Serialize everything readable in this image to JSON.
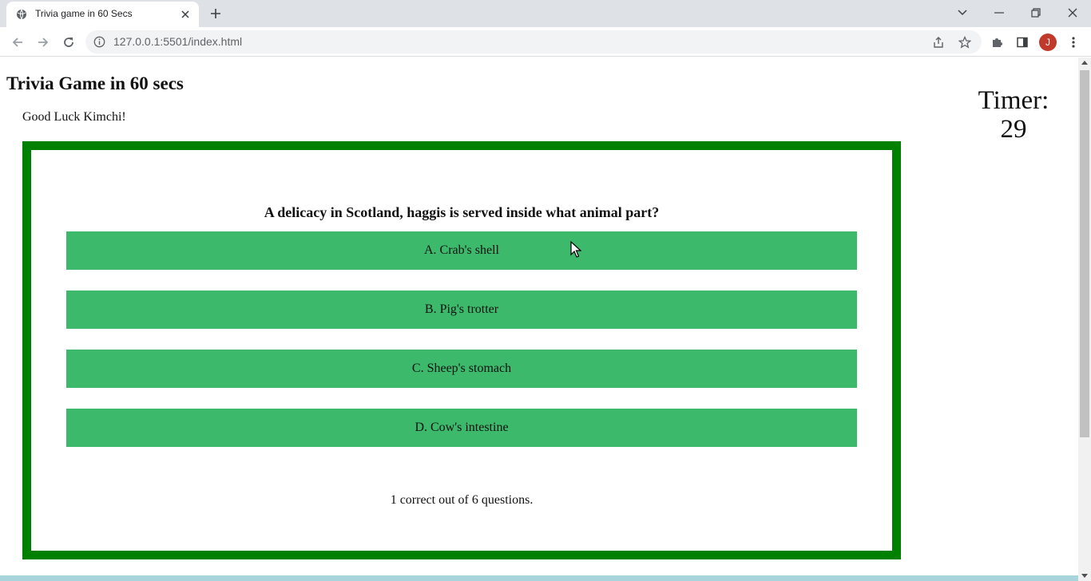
{
  "browser": {
    "tab_title": "Trivia game in 60 Secs",
    "url": "127.0.0.1:5501/index.html",
    "profile_initial": "J"
  },
  "page": {
    "title": "Trivia Game in 60 secs",
    "greeting": "Good Luck Kimchi!",
    "timer_label": "Timer:",
    "timer_value": "29"
  },
  "quiz": {
    "question": "A delicacy in Scotland, haggis is served inside what animal part?",
    "answers": [
      "A. Crab's shell",
      "B. Pig's trotter",
      "C. Sheep's stomach",
      "D. Cow's intestine"
    ],
    "score_text": "1 correct out of 6 questions."
  },
  "colors": {
    "border_green": "#008000",
    "answer_green": "#3cb96b",
    "bottom_strip": "#a8d4db"
  }
}
